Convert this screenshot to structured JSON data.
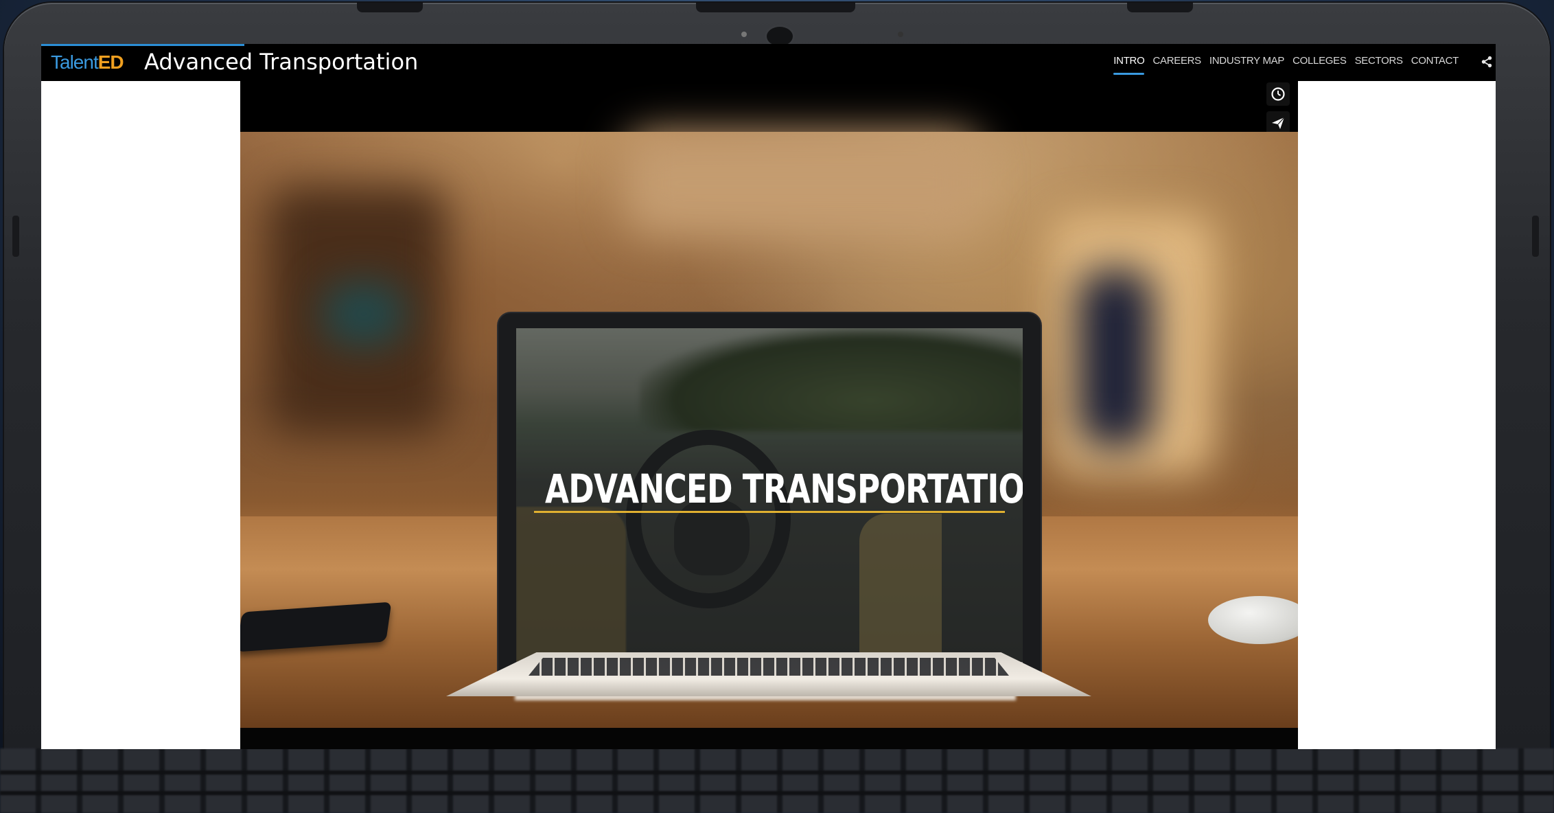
{
  "brand": {
    "logo_part1": "Talent",
    "logo_part2": "ED",
    "site_title": "Advanced Transportation"
  },
  "nav": {
    "items": [
      {
        "label": "INTRO",
        "active": true
      },
      {
        "label": "CAREERS",
        "active": false
      },
      {
        "label": "INDUSTRY MAP",
        "active": false
      },
      {
        "label": "COLLEGES",
        "active": false
      },
      {
        "label": "SECTORS",
        "active": false
      },
      {
        "label": "CONTACT",
        "active": false
      }
    ]
  },
  "video": {
    "title_text": "ADVANCED TRANSPORTATION",
    "side_buttons": [
      {
        "icon": "clock-icon"
      },
      {
        "icon": "paper-plane-icon"
      }
    ]
  },
  "colors": {
    "brand_blue": "#3a9ae0",
    "brand_orange": "#f0a020",
    "underline_gold": "#e0b030",
    "color_bar": [
      "#1e2d55",
      "#2d7fc8",
      "#6f6f8f",
      "#3a3f6a",
      "#2e9ad6",
      "#e9a21c",
      "#7a7a7a"
    ]
  }
}
